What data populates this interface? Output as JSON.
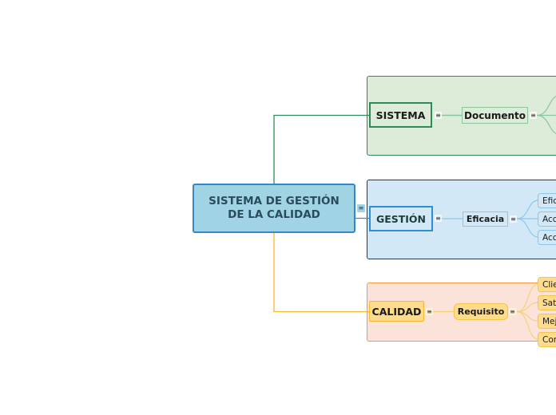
{
  "mindmap": {
    "central": {
      "line1": "SISTEMA DE GESTIÓN",
      "line2": "DE LA CALIDAD",
      "collapse_icon": "≡"
    },
    "branches": [
      {
        "label": "SISTEMA",
        "color": "#2e8b57",
        "collapse_icon": "≡",
        "sub": {
          "label": "Documento",
          "collapse_icon": "≡",
          "children": []
        }
      },
      {
        "label": "GESTIÓN",
        "color": "#2d8fd6",
        "collapse_icon": "≡",
        "sub": {
          "label": "Eficacia",
          "collapse_icon": "≡",
          "children": [
            "Efic",
            "Acci",
            "Acci"
          ]
        }
      },
      {
        "label": "CALIDAD",
        "color": "#f5b82e",
        "collapse_icon": "≡",
        "sub": {
          "label": "Requisito",
          "collapse_icon": "≡",
          "children": [
            "Clie",
            "Sati",
            "Mejo",
            "Con"
          ]
        }
      }
    ]
  }
}
